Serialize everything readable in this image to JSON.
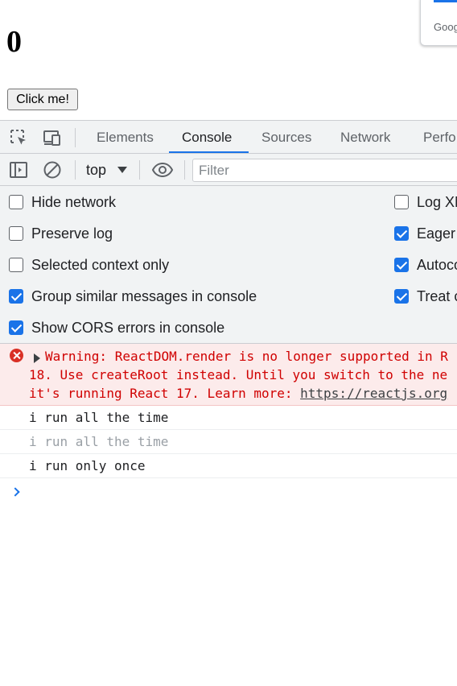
{
  "page": {
    "counter": "0",
    "button_label": "Click me!",
    "popup_text": "Goog"
  },
  "devtools": {
    "tabs": [
      "Elements",
      "Console",
      "Sources",
      "Network",
      "Perfo"
    ],
    "active_tab": "Console",
    "context": "top",
    "filter_placeholder": "Filter",
    "settings_left": [
      {
        "label": "Hide network",
        "checked": false
      },
      {
        "label": "Preserve log",
        "checked": false
      },
      {
        "label": "Selected context only",
        "checked": false
      },
      {
        "label": "Group similar messages in console",
        "checked": true
      },
      {
        "label": "Show CORS errors in console",
        "checked": true
      }
    ],
    "settings_right": [
      {
        "label": "Log XM",
        "checked": false
      },
      {
        "label": "Eager e",
        "checked": true
      },
      {
        "label": "Autoco",
        "checked": true
      },
      {
        "label": "Treat c",
        "checked": true
      }
    ],
    "error": {
      "line1": "Warning: ReactDOM.render is no longer supported in R",
      "line2": "18. Use createRoot instead. Until you switch to the ne",
      "line3_prefix": "it's running React 17. Learn more: ",
      "link": "https://reactjs.org"
    },
    "logs": [
      {
        "text": "i run all the time",
        "dim": false
      },
      {
        "text": "i run all the time",
        "dim": true
      },
      {
        "text": "i run only once",
        "dim": false
      }
    ],
    "colors": {
      "accent": "#1a73e8",
      "error": "#d00000",
      "error_bg": "#fcebeb"
    }
  }
}
